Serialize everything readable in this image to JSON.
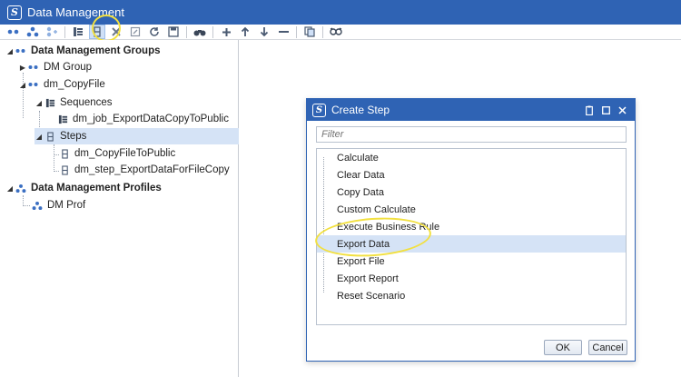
{
  "window": {
    "title": "Data Management",
    "logo": "S"
  },
  "toolbar": {
    "buttons": [
      "group-icon",
      "cluster-icon",
      "cluster-add-icon",
      "sequence-icon",
      "step-icon",
      "delete-icon",
      "rename-icon",
      "refresh-icon",
      "save-icon",
      "search-icon",
      "add-icon",
      "move-up-icon",
      "move-down-icon",
      "remove-icon",
      "copy-icon",
      "view-icon"
    ]
  },
  "tree": {
    "groups_header": "Data Management Groups",
    "dm_group": "DM Group",
    "dm_copyfile": "dm_CopyFile",
    "sequences": "Sequences",
    "sequence_item": "dm_job_ExportDataCopyToPublic",
    "steps": "Steps",
    "step_1": "dm_CopyFileToPublic",
    "step_2": "dm_step_ExportDataForFileCopy",
    "profiles_header": "Data Management Profiles",
    "dm_prof": "DM Prof"
  },
  "dialog": {
    "title": "Create Step",
    "filter_placeholder": "Filter",
    "items": [
      "Calculate",
      "Clear Data",
      "Copy Data",
      "Custom Calculate",
      "Execute Business Rule",
      "Export Data",
      "Export File",
      "Export Report",
      "Reset Scenario"
    ],
    "selected_item": "Export Data",
    "ok_label": "OK",
    "cancel_label": "Cancel"
  },
  "colors": {
    "titlebar": "#2f63b4",
    "selection": "#d5e3f6",
    "highlight": "#f2e040"
  }
}
